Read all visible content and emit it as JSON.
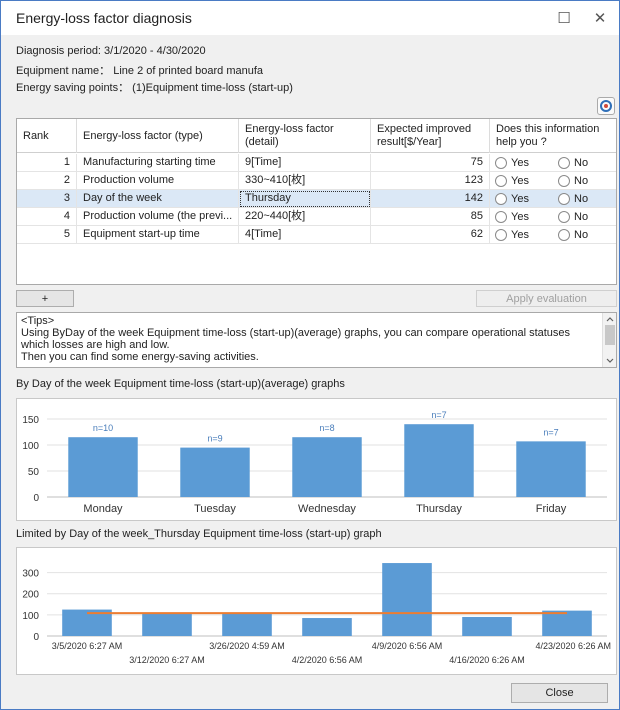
{
  "window": {
    "title": "Energy-loss factor diagnosis",
    "maximize_glyph": "☐",
    "close_glyph": "✕"
  },
  "info": {
    "period": "Diagnosis period: 3/1/2020 - 4/30/2020",
    "equipment": "Equipment name： Line 2 of printed board manufa",
    "saving_points": "Energy saving points： (1)Equipment time-loss (start-up)"
  },
  "grid": {
    "headers": {
      "rank": "Rank",
      "factor_type": "Energy-loss factor (type)",
      "factor_detail": "Energy-loss factor (detail)",
      "expected": "Expected improved result[$/Year]",
      "helpful": "Does this information help you ?"
    },
    "rows": [
      {
        "rank": "1",
        "type": "Manufacturing starting time",
        "detail": "9[Time]",
        "expected": "75",
        "yes": "Yes",
        "no": "No"
      },
      {
        "rank": "2",
        "type": "Production volume",
        "detail": "330~410[枚]",
        "expected": "123",
        "yes": "Yes",
        "no": "No"
      },
      {
        "rank": "3",
        "type": "Day of the week",
        "detail": "Thursday",
        "expected": "142",
        "yes": "Yes",
        "no": "No"
      },
      {
        "rank": "4",
        "type": "Production volume (the previ...",
        "detail": "220~440[枚]",
        "expected": "85",
        "yes": "Yes",
        "no": "No"
      },
      {
        "rank": "5",
        "type": "Equipment start-up time",
        "detail": "4[Time]",
        "expected": "62",
        "yes": "Yes",
        "no": "No"
      }
    ]
  },
  "buttons": {
    "add": "+",
    "apply": "Apply evaluation",
    "close": "Close"
  },
  "tips": {
    "line1": "<Tips>",
    "line2": "Using ByDay of the week Equipment time-loss (start-up)(average) graphs, you can compare operational statuses which losses are high and low.",
    "line3": "Then you can find some energy-saving activities."
  },
  "chart1_label": "By Day of the week Equipment time-loss (start-up)(average) graphs",
  "chart2_label": "Limited by Day of the week_Thursday  Equipment time-loss (start-up) graph",
  "chart_data": [
    {
      "type": "bar",
      "categories": [
        "Monday",
        "Tuesday",
        "Wednesday",
        "Thursday",
        "Friday"
      ],
      "values": [
        115,
        95,
        115,
        140,
        107
      ],
      "annotations": [
        "n=10",
        "n=9",
        "n=8",
        "n=7",
        "n=7"
      ],
      "ylim": [
        0,
        150
      ],
      "yticks": [
        "0",
        "50",
        "100",
        "150"
      ],
      "grid": true,
      "bar_color": "#5b9bd5"
    },
    {
      "type": "bar",
      "categories": [
        "3/5/2020 6:27 AM",
        "3/12/2020 6:27 AM",
        "3/26/2020 4:59 AM",
        "4/2/2020 6:56 AM",
        "4/9/2020 6:56 AM",
        "4/16/2020 6:26 AM",
        "4/23/2020 6:26 AM"
      ],
      "values": [
        125,
        108,
        105,
        85,
        345,
        90,
        120
      ],
      "average_line": 108,
      "ylim": [
        0,
        350
      ],
      "yticks": [
        "0",
        "100",
        "200",
        "300"
      ],
      "grid": true,
      "bar_color": "#5b9bd5",
      "line_color": "#ed7d31"
    }
  ]
}
